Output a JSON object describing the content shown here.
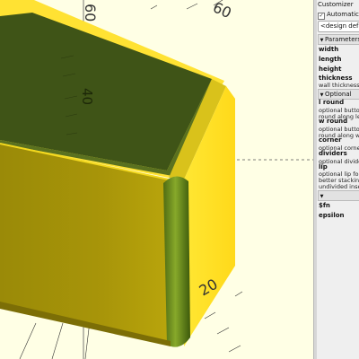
{
  "viewport": {
    "axis_labels": [
      "60",
      "40",
      "20"
    ]
  },
  "customizer": {
    "title": "Customizer",
    "auto_preview_label": "Automatic Pr",
    "design_select": "<design defaul",
    "groups": {
      "parameters": "Parameters",
      "optional": "Optional"
    },
    "params": [
      {
        "name": "width",
        "desc": ""
      },
      {
        "name": "length",
        "desc": ""
      },
      {
        "name": "height",
        "desc": ""
      },
      {
        "name": "thickness",
        "desc": "wall thickness"
      }
    ],
    "optional_params": [
      {
        "name": "l round",
        "desc1": "optional button",
        "desc2": "round along len"
      },
      {
        "name": "w round",
        "desc1": "optional button",
        "desc2": "round along wi"
      },
      {
        "name": "corner",
        "desc1": "optional corner",
        "desc2": ""
      },
      {
        "name": "dividers",
        "desc1": "optional divide",
        "desc2": ""
      },
      {
        "name": "lip",
        "desc1": "optional lip for",
        "desc2": "better stacking",
        "desc3": "undivided inse"
      }
    ],
    "hidden_params": [
      {
        "name": "$fn"
      },
      {
        "name": "epsilon"
      }
    ]
  }
}
